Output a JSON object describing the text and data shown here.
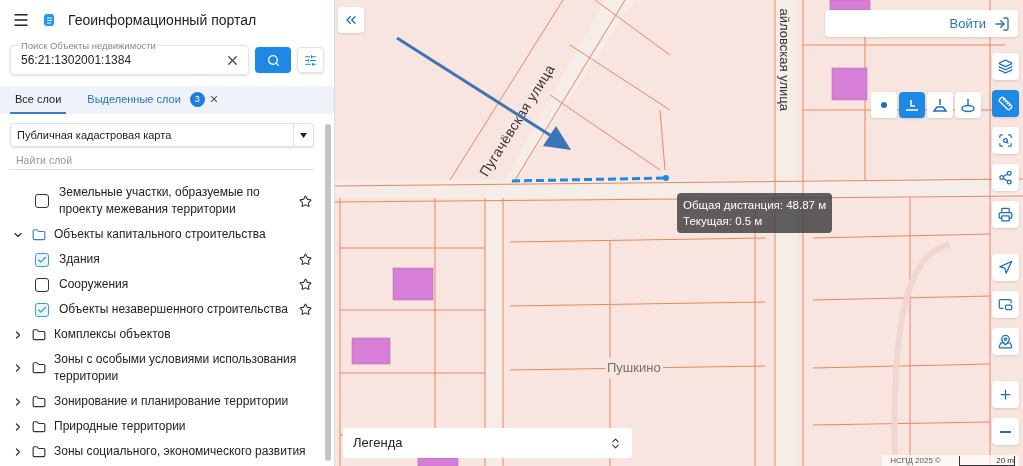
{
  "header": {
    "title": "Геоинформационный портал"
  },
  "search": {
    "label": "Поиск Объекты недвижимости",
    "value": "56:21:1302001:1384"
  },
  "tabs": [
    {
      "label": "Все слои",
      "selected": true
    },
    {
      "label": "Выделенные слои",
      "selected": false,
      "count": "3"
    }
  ],
  "layer_source": {
    "value": "Публичная кадастровая карта"
  },
  "layer_filter": {
    "placeholder": "Найти слой"
  },
  "layers": [
    {
      "kind": "layer",
      "label": "Земельные участки, образуемые по проекту межевания территории",
      "checked": false
    },
    {
      "kind": "group",
      "label": "Объекты капитального строительства",
      "expanded": true,
      "children": [
        {
          "kind": "layer",
          "label": "Здания",
          "checked": true
        },
        {
          "kind": "layer",
          "label": "Сооружения",
          "checked": false
        },
        {
          "kind": "layer",
          "label": "Объекты незавершенного строительства",
          "checked": true
        }
      ]
    },
    {
      "kind": "group",
      "label": "Комплексы объектов",
      "expanded": false
    },
    {
      "kind": "group",
      "label": "Зоны с особыми условиями использования территории",
      "expanded": false
    },
    {
      "kind": "group",
      "label": "Зонирование и планирование территории",
      "expanded": false
    },
    {
      "kind": "group",
      "label": "Природные территории",
      "expanded": false
    },
    {
      "kind": "group",
      "label": "Зоны социального, экономического развития",
      "expanded": false
    }
  ],
  "map": {
    "street_labels": [
      {
        "kind": "diagonal",
        "label": "Пугачёвская улица"
      },
      {
        "kind": "vertical",
        "label": "айловская улица"
      }
    ],
    "place_label": "Пушкино",
    "measurement": {
      "total": "Общая дистанция: 48.87 м",
      "current": "Текущая: 0.5 м"
    },
    "login": "Войти",
    "measure_modes": [
      {
        "kind": "point",
        "selected": false
      },
      {
        "kind": "line",
        "selected": true
      },
      {
        "kind": "area",
        "selected": false
      },
      {
        "kind": "circle",
        "selected": false
      }
    ],
    "toolbar": [
      {
        "kind": "layers",
        "selected": false
      },
      {
        "kind": "measure",
        "selected": true
      },
      {
        "kind": "select",
        "selected": false
      },
      {
        "kind": "share",
        "selected": false
      },
      {
        "kind": "print",
        "selected": false
      },
      {
        "kind": "navigate",
        "selected": false
      },
      {
        "kind": "minimap",
        "selected": false
      },
      {
        "kind": "locate",
        "selected": false
      },
      {
        "kind": "zoom-in",
        "selected": false
      },
      {
        "kind": "zoom-out",
        "selected": false
      }
    ],
    "legend": "Легенда",
    "attribution": "НСПД 2025 ©",
    "scale": "20 m"
  }
}
